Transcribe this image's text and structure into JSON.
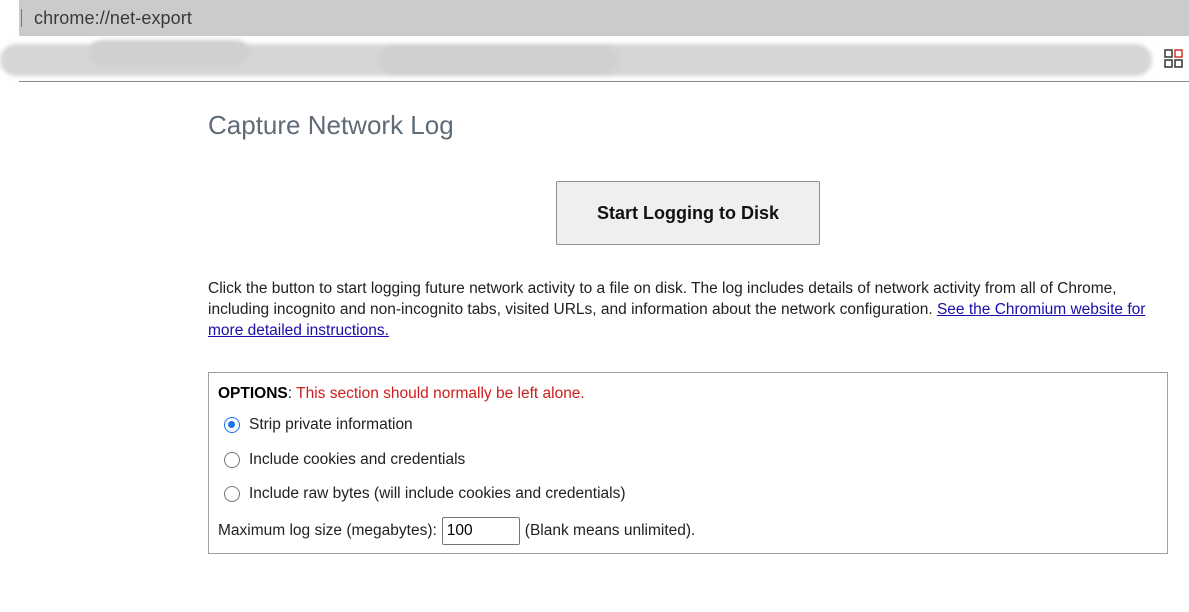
{
  "browser": {
    "url": "chrome://net-export"
  },
  "page": {
    "title": "Capture Network Log",
    "start_button_label": "Start Logging to Disk",
    "description_text": "Click the button to start logging future network activity to a file on disk. The log includes details of network activity from all of Chrome, including incognito and non-incognito tabs, visited URLs, and information about the network configuration. ",
    "description_link": "See the Chromium website for more detailed instructions."
  },
  "options": {
    "title": "OPTIONS",
    "separator": ": ",
    "warning": "This section should normally be left alone.",
    "radio_options": [
      {
        "label": "Strip private information",
        "checked": true
      },
      {
        "label": "Include cookies and credentials",
        "checked": false
      },
      {
        "label": "Include raw bytes (will include cookies and credentials)",
        "checked": false
      }
    ],
    "max_size_label": "Maximum log size (megabytes):",
    "max_size_value": "100",
    "max_size_hint": "(Blank means unlimited)."
  },
  "colors": {
    "warning": "#d01c1c",
    "link": "#1a0dab",
    "radio_checked": "#1a73e8"
  }
}
